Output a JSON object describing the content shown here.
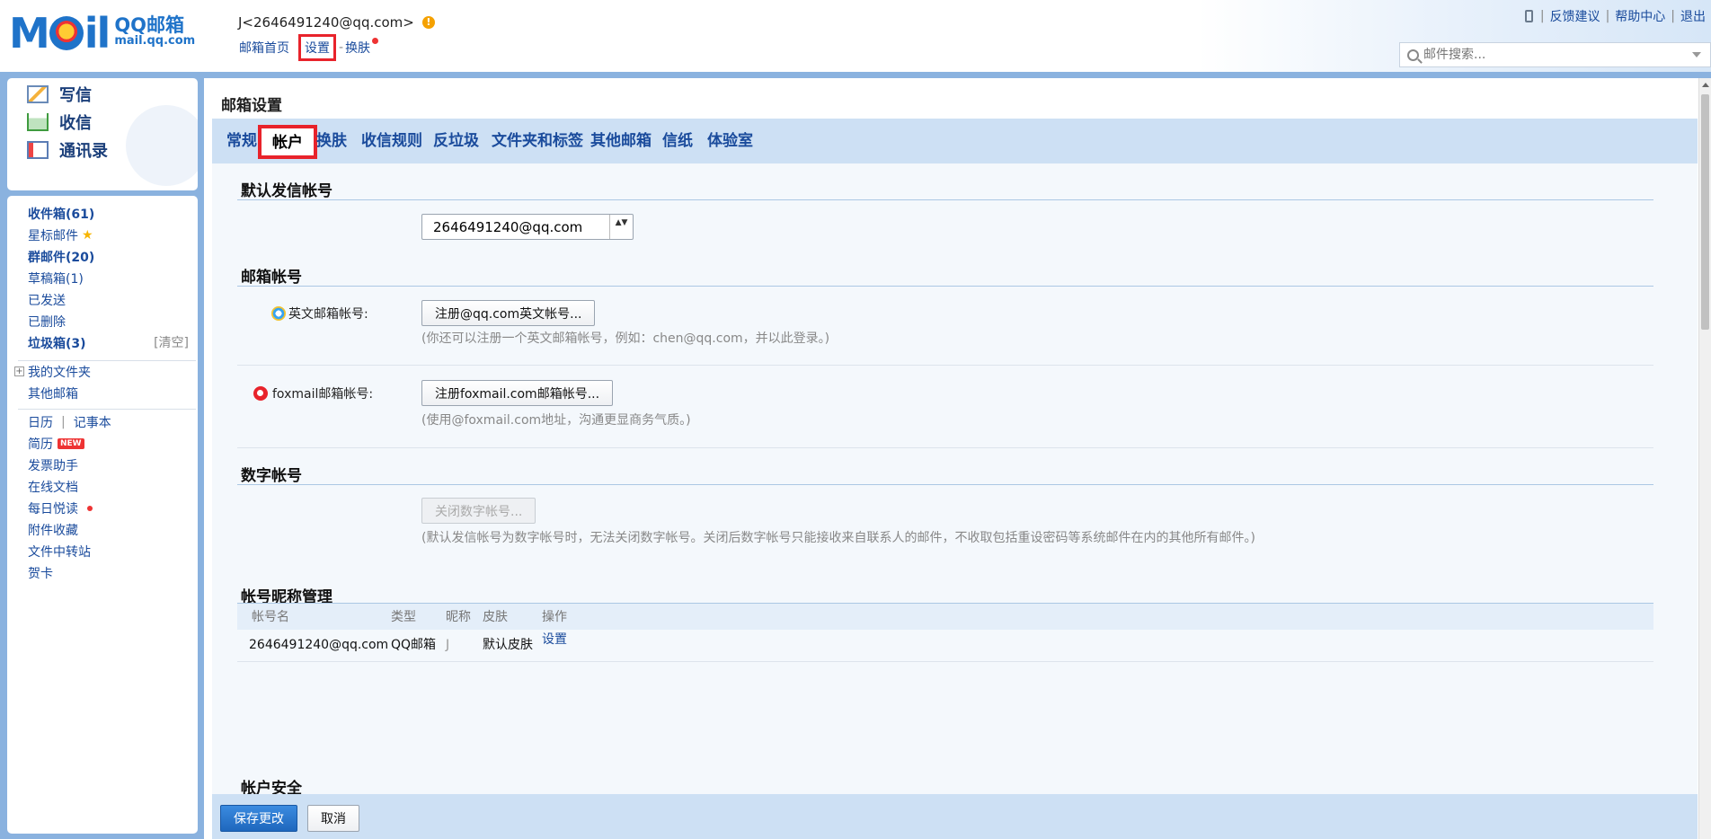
{
  "brand": {
    "logo_mark": "Mail",
    "name_cn": "QQ邮箱",
    "url": "mail.qq.com"
  },
  "account": {
    "display": "J<2646491240@qq.com>",
    "warn_glyph": "!"
  },
  "topnav": {
    "home": "邮箱首页",
    "settings": "设置",
    "sep": "-",
    "skin": "换肤"
  },
  "tools": {
    "feedback": "反馈建议",
    "help": "帮助中心",
    "logout": "退出",
    "sep": "|"
  },
  "search": {
    "placeholder": "邮件搜索..."
  },
  "compose": {
    "write": "写信",
    "inbox": "收信",
    "contacts": "通讯录"
  },
  "folders": {
    "inbox": "收件箱(61)",
    "starred": "星标邮件",
    "star_glyph": "★",
    "groups": "群邮件(20)",
    "drafts": "草稿箱(1)",
    "sent": "已发送",
    "deleted": "已删除",
    "spam": "垃圾箱(3)",
    "clear": "[清空]",
    "expand_glyph": "+",
    "my_folders": "我的文件夹",
    "other_mailboxes": "其他邮箱",
    "calendar": "日历",
    "tools_sep": "|",
    "notes": "记事本",
    "resume": "简历",
    "new_badge": "NEW",
    "invoice": "发票助手",
    "docs": "在线文档",
    "daily_read": "每日悦读",
    "attachments": "附件收藏",
    "transfer": "文件中转站",
    "cards": "贺卡"
  },
  "main": {
    "title": "邮箱设置",
    "tabs": [
      "常规",
      "帐户",
      "换肤",
      "收信规则",
      "反垃圾",
      "文件夹和标签",
      "其他邮箱",
      "信纸",
      "体验室"
    ],
    "active_tab": "帐户"
  },
  "sections": {
    "default_sender": {
      "title": "默认发信帐号",
      "select_value": "2646491240@qq.com",
      "arrows": "▲▼"
    },
    "mailbox_accounts": {
      "title": "邮箱帐号",
      "english_label": "英文邮箱帐号:",
      "english_button": "注册@qq.com英文帐号...",
      "english_hint": "(你还可以注册一个英文邮箱帐号，例如：chen@qq.com，并以此登录。)",
      "foxmail_label": "foxmail邮箱帐号:",
      "foxmail_button": "注册foxmail.com邮箱帐号...",
      "foxmail_hint": "(使用@foxmail.com地址，沟通更显商务气质。)"
    },
    "digital_account": {
      "title": "数字帐号",
      "button": "关闭数字帐号...",
      "hint": "(默认发信帐号为数字帐号时，无法关闭数字帐号。关闭后数字帐号只能接收来自联系人的邮件，不收取包括重设密码等系统邮件在内的其他所有邮件。)"
    },
    "nickname_mgmt": {
      "title": "帐号昵称管理",
      "columns": [
        "帐号名",
        "类型",
        "昵称",
        "皮肤",
        "操作"
      ],
      "rows": [
        {
          "account": "2646491240@qq.com",
          "type": "QQ邮箱",
          "nickname": "J",
          "skin": "默认皮肤",
          "action": "设置"
        }
      ]
    },
    "account_security": {
      "title": "帐户安全"
    }
  },
  "footer": {
    "save": "保存更改",
    "cancel": "取消"
  },
  "colors": {
    "brand_blue": "#1f73c9",
    "highlight_red": "#e8232b",
    "frame_blue": "#8ab2df",
    "tab_bar": "#cde0f4"
  }
}
